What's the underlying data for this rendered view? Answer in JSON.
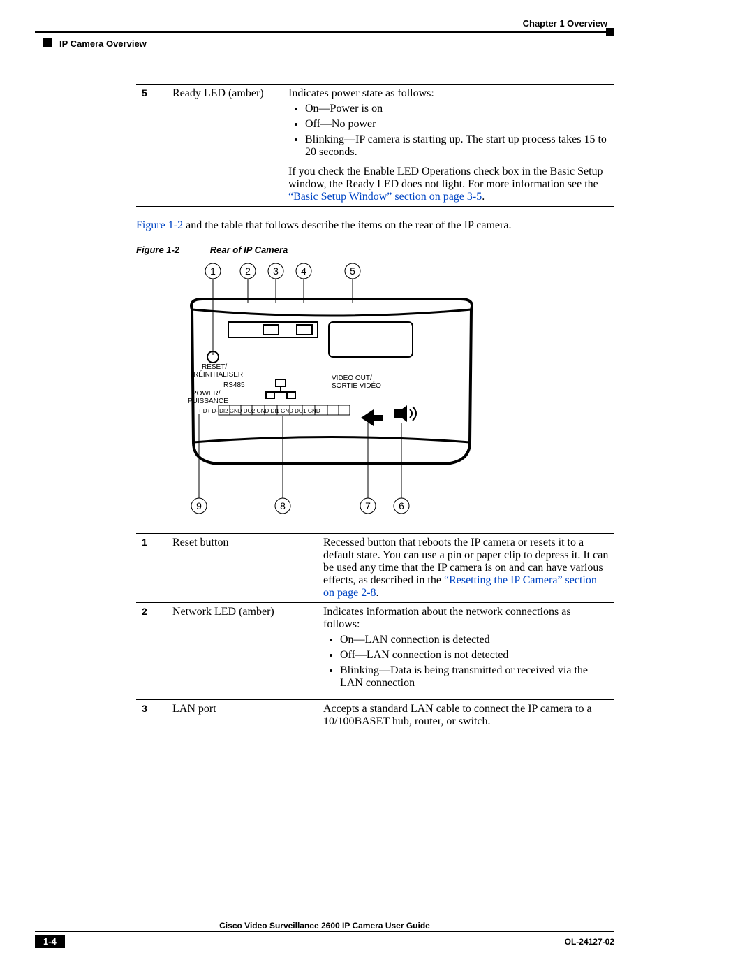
{
  "header": {
    "chapter": "Chapter 1      Overview",
    "section": "IP Camera Overview"
  },
  "table1": {
    "row": {
      "num": "5",
      "label": "Ready LED (amber)",
      "intro": "Indicates power state as follows:",
      "bullets": [
        "On—Power is on",
        "Off—No power",
        "Blinking—IP camera is starting up. The start up process takes 15 to 20 seconds."
      ],
      "after1": "If you check the Enable LED Operations check box in the Basic Setup window, the Ready LED does not light. For more information see the ",
      "link1": "“Basic Setup Window” section on page 3-5",
      "after1b": "."
    }
  },
  "middle_para_pre": "Figure 1-2",
  "middle_para_post": " and the table that follows describe the items on the rear of the IP camera.",
  "figure": {
    "num": "Figure 1-2",
    "title": "Rear of IP Camera",
    "callouts_top": [
      "1",
      "2",
      "3",
      "4",
      "5"
    ],
    "callouts_bottom": [
      "9",
      "8",
      "7",
      "6"
    ],
    "labels": {
      "reset": "RESET/",
      "reset2": "RÉINITIALISER",
      "rs485": "RS485",
      "power": "POWER/",
      "power2": "PUISSANCE",
      "video": "VIDEO OUT/",
      "video2": "SORTIE VIDÉO",
      "pins": "−   +    D+  D-  DI2 GND DO2 GND DI1 GND DO1 GND"
    }
  },
  "table2": {
    "rows": [
      {
        "num": "1",
        "label": "Reset button",
        "desc_pre": "Recessed button that reboots the IP camera or resets it to a default state. You can use a pin or paper clip to depress it. It can be used any time that the IP camera is on and can have various effects, as described in the ",
        "link": "“Resetting the IP Camera” section on page 2-8",
        "desc_post": "."
      },
      {
        "num": "2",
        "label": "Network LED (amber)",
        "intro": "Indicates information about the network connections as follows:",
        "bullets": [
          "On—LAN connection is detected",
          "Off—LAN connection is not detected",
          "Blinking—Data is being transmitted or received via the LAN connection"
        ]
      },
      {
        "num": "3",
        "label": "LAN port",
        "desc": "Accepts a standard LAN cable to connect the IP camera to a 10/100BASET hub, router, or switch."
      }
    ]
  },
  "footer": {
    "title": "Cisco Video Surveillance 2600 IP Camera User Guide",
    "page": "1-4",
    "doc": "OL-24127-02"
  }
}
